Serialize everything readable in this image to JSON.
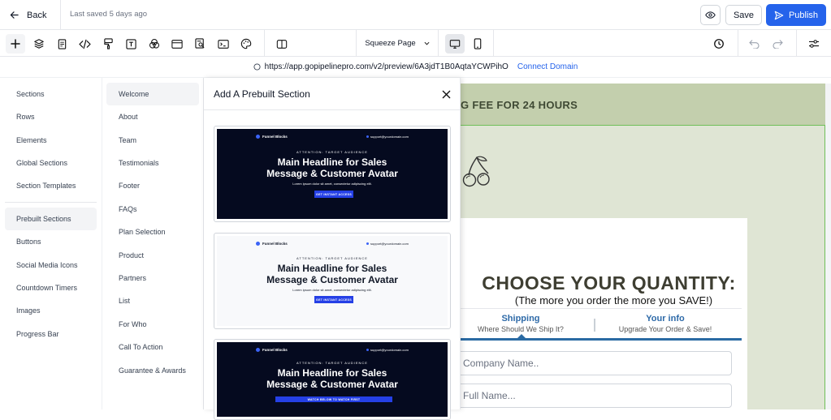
{
  "topbar": {
    "back_label": "Back",
    "last_saved": "Last saved 5 days ago",
    "save_label": "Save",
    "publish_label": "Publish"
  },
  "toolbar": {
    "page_selector": "Squeeze Page",
    "icons": [
      "plus-icon",
      "layers-icon",
      "page-icon",
      "code-icon",
      "paint-brush-icon",
      "text-icon",
      "color-circles-icon",
      "layout-icon",
      "search-doc-icon",
      "terminal-icon",
      "palette-icon",
      "sidebar-toggle-icon",
      "desktop-icon",
      "mobile-icon",
      "history-icon",
      "undo-icon",
      "redo-icon",
      "settings-sliders-icon"
    ]
  },
  "urlbar": {
    "url": "https://app.gopipelinepro.com/v2/preview/6A3jdT1B0AqtaYCWPihO",
    "connect_label": "Connect Domain"
  },
  "left_nav": {
    "items": [
      {
        "label": "Sections"
      },
      {
        "label": "Rows"
      },
      {
        "label": "Elements"
      },
      {
        "label": "Global Sections"
      },
      {
        "label": "Section Templates"
      },
      {
        "label": "Prebuilt Sections",
        "active": true
      },
      {
        "label": "Buttons"
      },
      {
        "label": "Social Media Icons"
      },
      {
        "label": "Countdown Timers"
      },
      {
        "label": "Images"
      },
      {
        "label": "Progress Bar"
      }
    ]
  },
  "sub_nav": {
    "items": [
      {
        "label": "Welcome",
        "active": true
      },
      {
        "label": "About"
      },
      {
        "label": "Team"
      },
      {
        "label": "Testimonials"
      },
      {
        "label": "Footer"
      },
      {
        "label": "FAQs"
      },
      {
        "label": "Plan Selection"
      },
      {
        "label": "Product"
      },
      {
        "label": "Partners"
      },
      {
        "label": "List"
      },
      {
        "label": "For Who"
      },
      {
        "label": "Call To Action"
      },
      {
        "label": "Guarantee & Awards"
      }
    ]
  },
  "panel": {
    "title": "Add A Prebuilt Section",
    "thumbnails": [
      {
        "theme": "dark",
        "logo": "Funnel Blocks",
        "email": "support@yourdomain.com",
        "eyebrow": "ATTENTION: TARGET AUDIENCE",
        "headline_1": "Main Headline for Sales",
        "headline_2": "Message & Customer Avatar",
        "sub": "Lorem ipsum dolor sit amet, consectetur adipiscing elit.",
        "button": "GET INSTANT ACCESS"
      },
      {
        "theme": "light",
        "logo": "Funnel Blocks",
        "email": "support@yourdomain.com",
        "eyebrow": "ATTENTION: TARGET AUDIENCE",
        "headline_1": "Main Headline for Sales",
        "headline_2": "Message & Customer Avatar",
        "sub": "Lorem ipsum dolor sit amet, consectetur adipiscing elit.",
        "button": "GET INSTANT ACCESS"
      },
      {
        "theme": "dark",
        "logo": "Funnel Blocks",
        "email": "support@yourdomain.com",
        "eyebrow": "ATTENTION: TARGET AUDIENCE",
        "headline_1": "Main Headline for Sales",
        "headline_2": "Message & Customer Avatar",
        "button": "WATCH BELOW TO WATCH FIRST"
      }
    ]
  },
  "canvas": {
    "banner": "G FEE FOR 24 HOURS",
    "title": "CHOOSE YOUR QUANTITY:",
    "subtitle": "(The more you order the more you SAVE!)",
    "steps": [
      {
        "title": "Shipping",
        "sub": "Where Should We Ship It?"
      },
      {
        "title": "Your info",
        "sub": "Upgrade Your Order & Save!"
      }
    ],
    "fields": [
      {
        "placeholder": "Company Name.."
      },
      {
        "placeholder": "Full Name..."
      }
    ]
  },
  "colors": {
    "accent": "#2563eb",
    "banner_bg": "#c3cfad",
    "canvas_bg": "#dfe5d4",
    "step_blue": "#2e6aa8",
    "thumb_dark": "#050a1f"
  }
}
